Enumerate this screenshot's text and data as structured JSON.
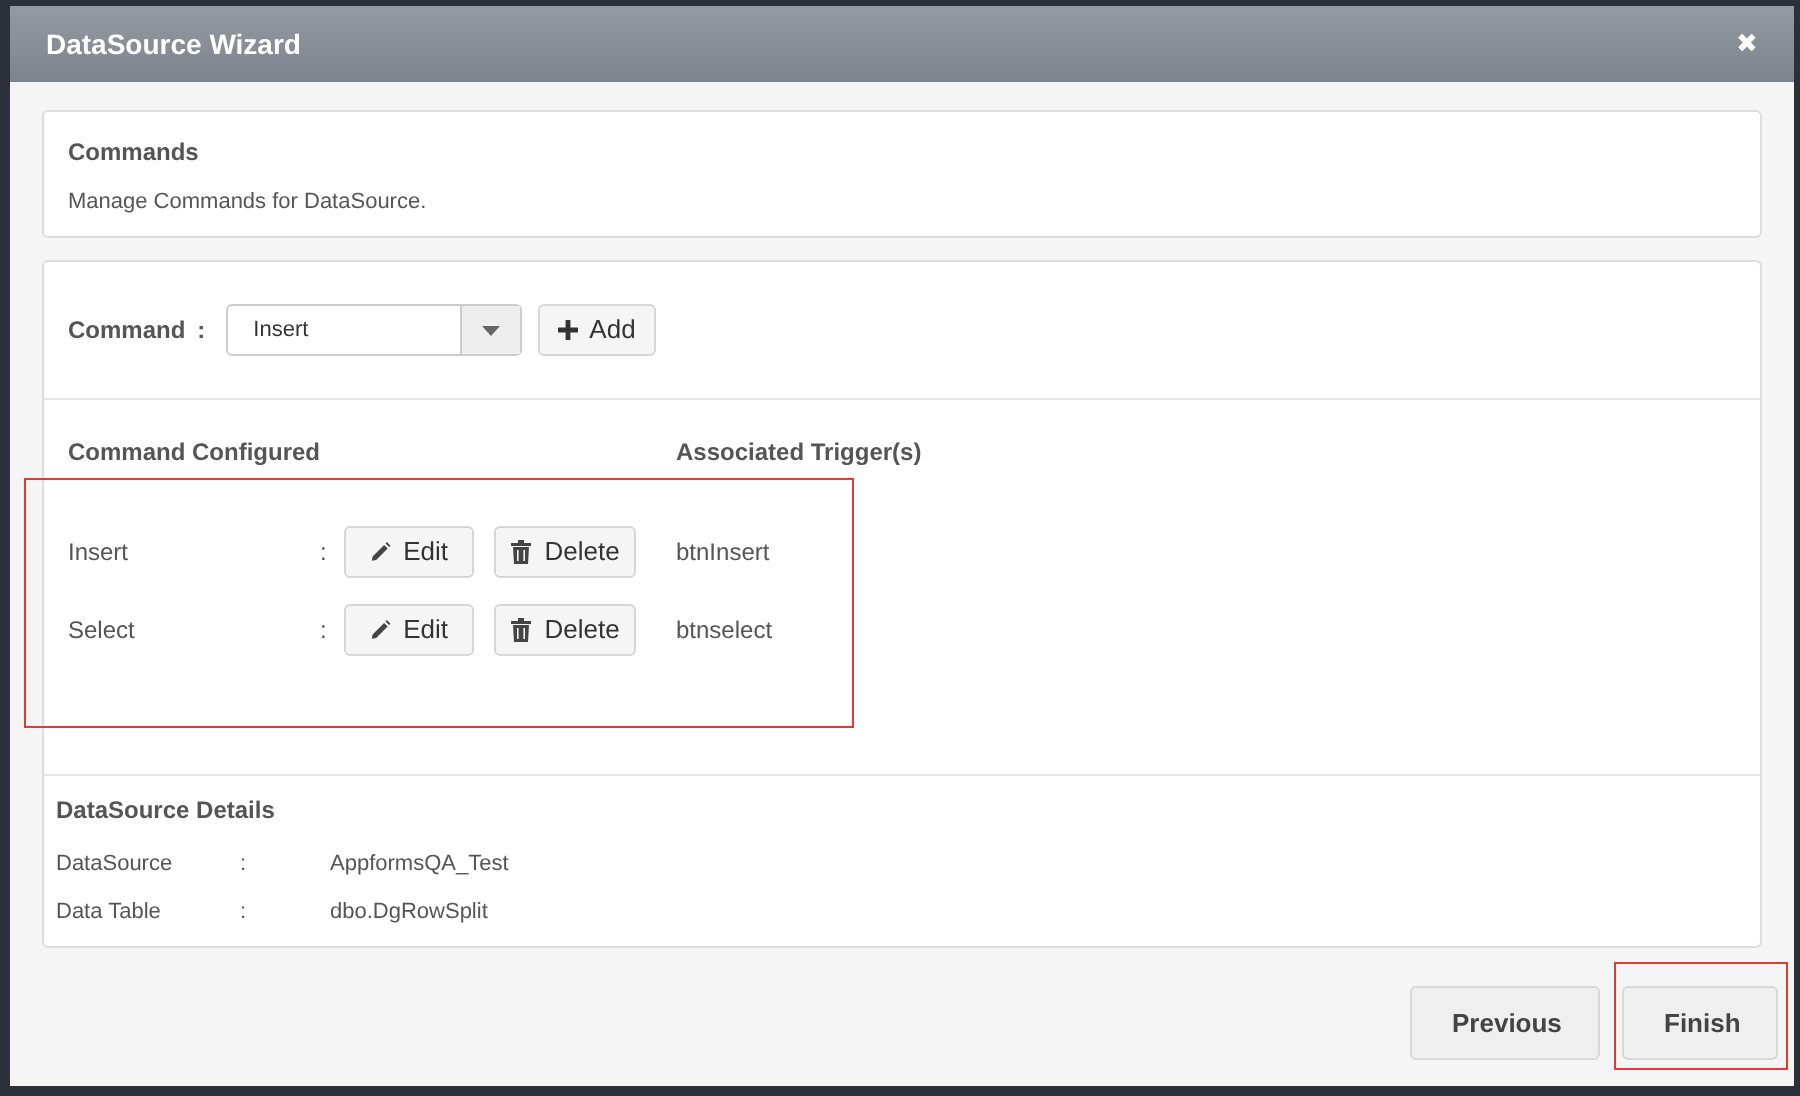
{
  "window": {
    "title": "DataSource Wizard",
    "close": "✖"
  },
  "intro": {
    "title": "Commands",
    "description": "Manage Commands for DataSource."
  },
  "command_picker": {
    "label": "Command",
    "separator": ":",
    "value": "Insert",
    "add_button": "Add"
  },
  "commands": {
    "heading": "Command Configured",
    "trigger_heading": "Associated Trigger(s)",
    "highlighted": true,
    "rows": [
      {
        "name": "Insert",
        "separator": ":",
        "edit": "Edit",
        "delete": "Delete",
        "trigger": "btnInsert"
      },
      {
        "name": "Select",
        "separator": ":",
        "edit": "Edit",
        "delete": "Delete",
        "trigger": "btnselect"
      }
    ]
  },
  "details": {
    "heading": "DataSource Details",
    "rows": [
      {
        "label": "DataSource",
        "separator": ":",
        "value": "AppformsQA_Test"
      },
      {
        "label": "Data Table",
        "separator": ":",
        "value": "dbo.DgRowSplit"
      }
    ]
  },
  "footer": {
    "buttons": [
      {
        "label": "Previous",
        "highlighted": false
      },
      {
        "label": "Finish",
        "highlighted": true
      }
    ]
  }
}
